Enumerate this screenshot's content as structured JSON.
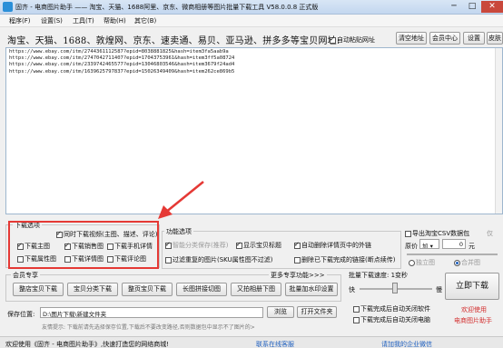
{
  "window": {
    "title": "固齐 - 电商图片助手 —— 淘宝、天猫、1688阿里、京东、微商相册等图片批量下载工具 V58.0.0.8 正式版",
    "minimize": "─",
    "maximize": "□",
    "close": "✕"
  },
  "menu": [
    "程序(F)",
    "设置(S)",
    "工具(T)",
    "帮助(H)",
    "其它(B)"
  ],
  "urlbar": {
    "label": "淘宝、天猫、1688、敦煌网、京东、速卖通、易贝、亚马逊、拼多多等宝贝网址:",
    "auto_paste": "自动粘贴网址",
    "clear_btn": "清空地址",
    "member_btn": "会员中心",
    "settings_btn": "设置",
    "skin_btn": "皮肤"
  },
  "urls": [
    "https://www.ebay.com/itm/2744361112587?epid=8038881825&hash=item3fa5aab9a",
    "https://www.ebay.com/itm/2747042711407?epid=17043753961&hash=item3ff5a08724",
    "https://www.ebay.com/itm/2339742465577?epid=13046803546&hash=item3679f24ad4",
    "https://www.ebay.com/itm/1639625797837?epid=15026349409&hash=item262ce869b5"
  ],
  "download_options": {
    "title": "下载选项",
    "items": [
      {
        "label": "同时下载视频(主图、描述、评论)",
        "checked": true
      },
      {
        "label": "下载主图",
        "checked": true
      },
      {
        "label": "下载销售图",
        "checked": true
      },
      {
        "label": "下载手机详情",
        "checked": false
      },
      {
        "label": "下载属性图",
        "checked": false
      },
      {
        "label": "下载详情图",
        "checked": false
      },
      {
        "label": "下载评论图",
        "checked": false
      }
    ]
  },
  "function_options": {
    "title": "功能选项",
    "smart_classify": "智能分类保存(推荐)",
    "show_title": "显示宝贝标题",
    "auto_delete": "自动删除详情页中的外链",
    "filter_repeat": "过滤重复的图片(SKU属性图不过滤)",
    "delete_downloaded": "删除已下载完成的链接(断点续传)"
  },
  "export_options": {
    "export_csv": "导出淘宝CSV数据包",
    "keep_label": "仅",
    "price_label": "原价",
    "price_op": "加",
    "price_value": "0",
    "price_unit": "元",
    "radio_a": "独立图",
    "radio_b": "合并图"
  },
  "member": {
    "title": "会员专享",
    "more": "更多专享功能>>>",
    "buttons": [
      "整店宝贝下载",
      "宝贝分类下载",
      "整页宝贝下载",
      "长图拼接切图",
      "又拍相册下图",
      "批量加水印设置"
    ]
  },
  "speed": {
    "label": "批量下载速度: 1变秒",
    "fast": "快",
    "slow": "慢"
  },
  "start_btn": "立即下载",
  "save": {
    "label": "保存位置:",
    "path": "D:\\图片下载\\新建文件夹",
    "browse": "浏览",
    "open": "打开文件夹",
    "hint": "友情提示: 下载前请先选择保存位置,下载后不要改变路径,否则数据包中显示不了图片的>"
  },
  "after_download": {
    "open_folder": "下载完成后自动关闭软件",
    "shutdown": "下载完成后自动关闭电脑"
  },
  "welcome": {
    "line1": "欢迎使用",
    "line2": "电商图片助手"
  },
  "status": {
    "left": "欢迎使用《固齐 - 电商图片助手》,快速打造您的网络商城!",
    "middle": "联系在线客服",
    "right": "请加我的企业微信"
  },
  "colors": {
    "highlight_frame": "#e53935",
    "link_blue": "#1e5fbf",
    "welcome_red": "#d32f2f"
  }
}
